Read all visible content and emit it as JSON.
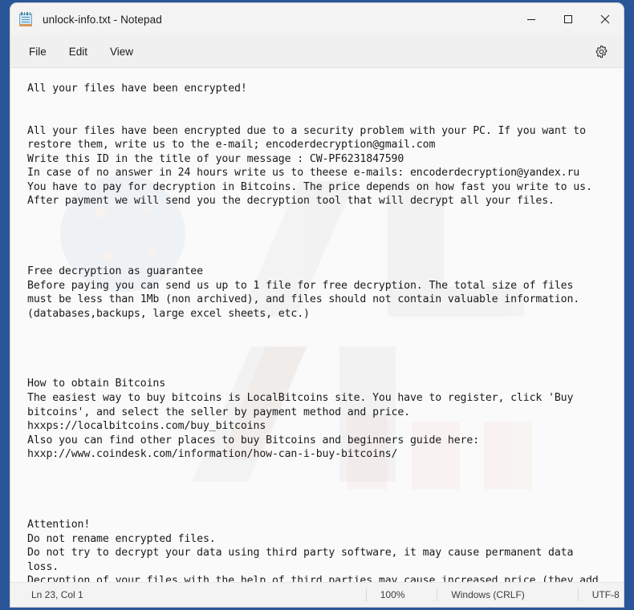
{
  "window": {
    "title": "unlock-info.txt - Notepad",
    "icon": "notepad-icon",
    "controls": {
      "minimize": "minimize-icon",
      "maximize": "maximize-icon",
      "close": "close-icon"
    }
  },
  "menu": {
    "items": [
      {
        "label": "File"
      },
      {
        "label": "Edit"
      },
      {
        "label": "View"
      }
    ],
    "settings_icon": "gear-icon"
  },
  "document": {
    "filename": "unlock-info.txt",
    "content": "All your files have been encrypted!\n\n\nAll your files have been encrypted due to a security problem with your PC. If you want to\nrestore them, write us to the e-mail; encoderdecryption@gmail.com\nWrite this ID in the title of your message : CW-PF6231847590\nIn case of no answer in 24 hours write us to theese e-mails: encoderdecryption@yandex.ru\nYou have to pay for decryption in Bitcoins. The price depends on how fast you write to us.\nAfter payment we will send you the decryption tool that will decrypt all your files.\n\n\n\n\nFree decryption as guarantee\nBefore paying you can send us up to 1 file for free decryption. The total size of files\nmust be less than 1Mb (non archived), and files should not contain valuable information.\n(databases,backups, large excel sheets, etc.)\n\n\n\n\nHow to obtain Bitcoins\nThe easiest way to buy bitcoins is LocalBitcoins site. You have to register, click 'Buy\nbitcoins', and select the seller by payment method and price.\nhxxps://localbitcoins.com/buy_bitcoins\nAlso you can find other places to buy Bitcoins and beginners guide here:\nhxxp://www.coindesk.com/information/how-can-i-buy-bitcoins/\n\n\n\n\nAttention!\nDo not rename encrypted files.\nDo not try to decrypt your data using third party software, it may cause permanent data\nloss.\nDecryption of your files with the help of third parties may cause increased price (they add\ntheir fee to our) or you can become a victim of a scam.",
    "contacts": {
      "email_primary": "encoderdecryption@gmail.com",
      "email_secondary": "encoderdecryption@yandex.ru",
      "victim_id": "CW-PF6231847590",
      "links": [
        "hxxps://localbitcoins.com/buy_bitcoins",
        "hxxp://www.coindesk.com/information/how-can-i-buy-bitcoins/"
      ]
    }
  },
  "status_bar": {
    "position": "Ln 23, Col 1",
    "zoom": "100%",
    "line_ending": "Windows (CRLF)",
    "encoding": "UTF-8"
  },
  "colors": {
    "frame_blue": "#2a5699",
    "window_chrome": "#f3f3f3",
    "menu_bar": "#f0f0f0",
    "text_area": "#fafafa",
    "text": "#1a1a1a"
  }
}
